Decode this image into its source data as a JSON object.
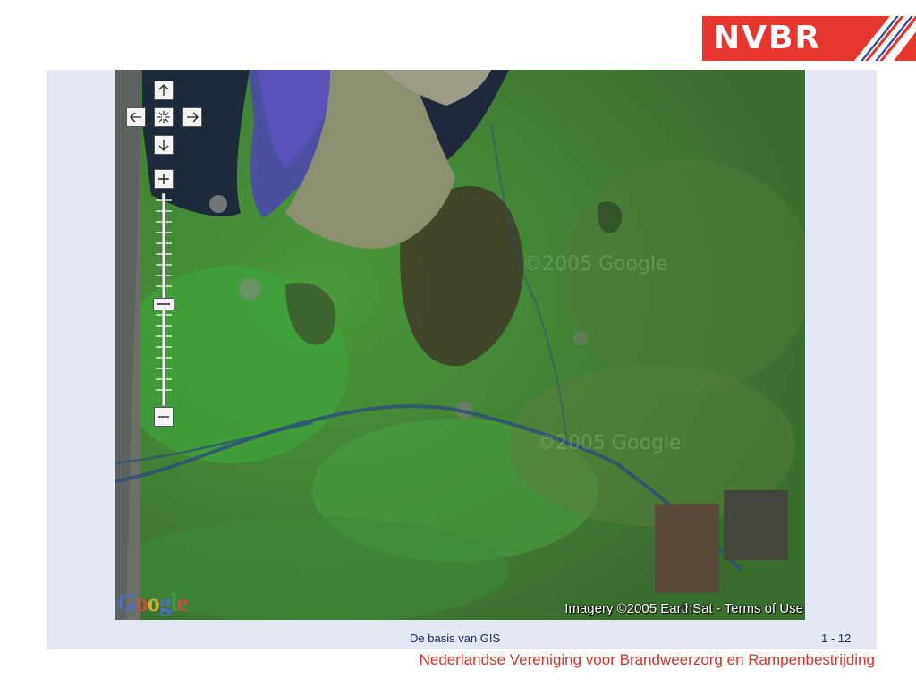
{
  "logo": {
    "text": "NVBR",
    "brand_color": "#e8362d"
  },
  "map": {
    "copyright": "Imagery ©2005 EarthSat - Terms of Use",
    "provider_logo": "Google",
    "watermark": "©2005 Google",
    "controls": {
      "pan_up": "arrow-up-icon",
      "pan_left": "arrow-left-icon",
      "pan_center": "recenter-icon",
      "pan_right": "arrow-right-icon",
      "pan_down": "arrow-down-icon",
      "zoom_in": "plus-icon",
      "zoom_out": "minus-icon"
    },
    "zoom_level_fraction": 0.48
  },
  "footer": {
    "title": "De basis van GIS",
    "page": "1 - 12",
    "organization": "Nederlandse Vereniging voor Brandweerzorg en Rampenbestrijding"
  }
}
